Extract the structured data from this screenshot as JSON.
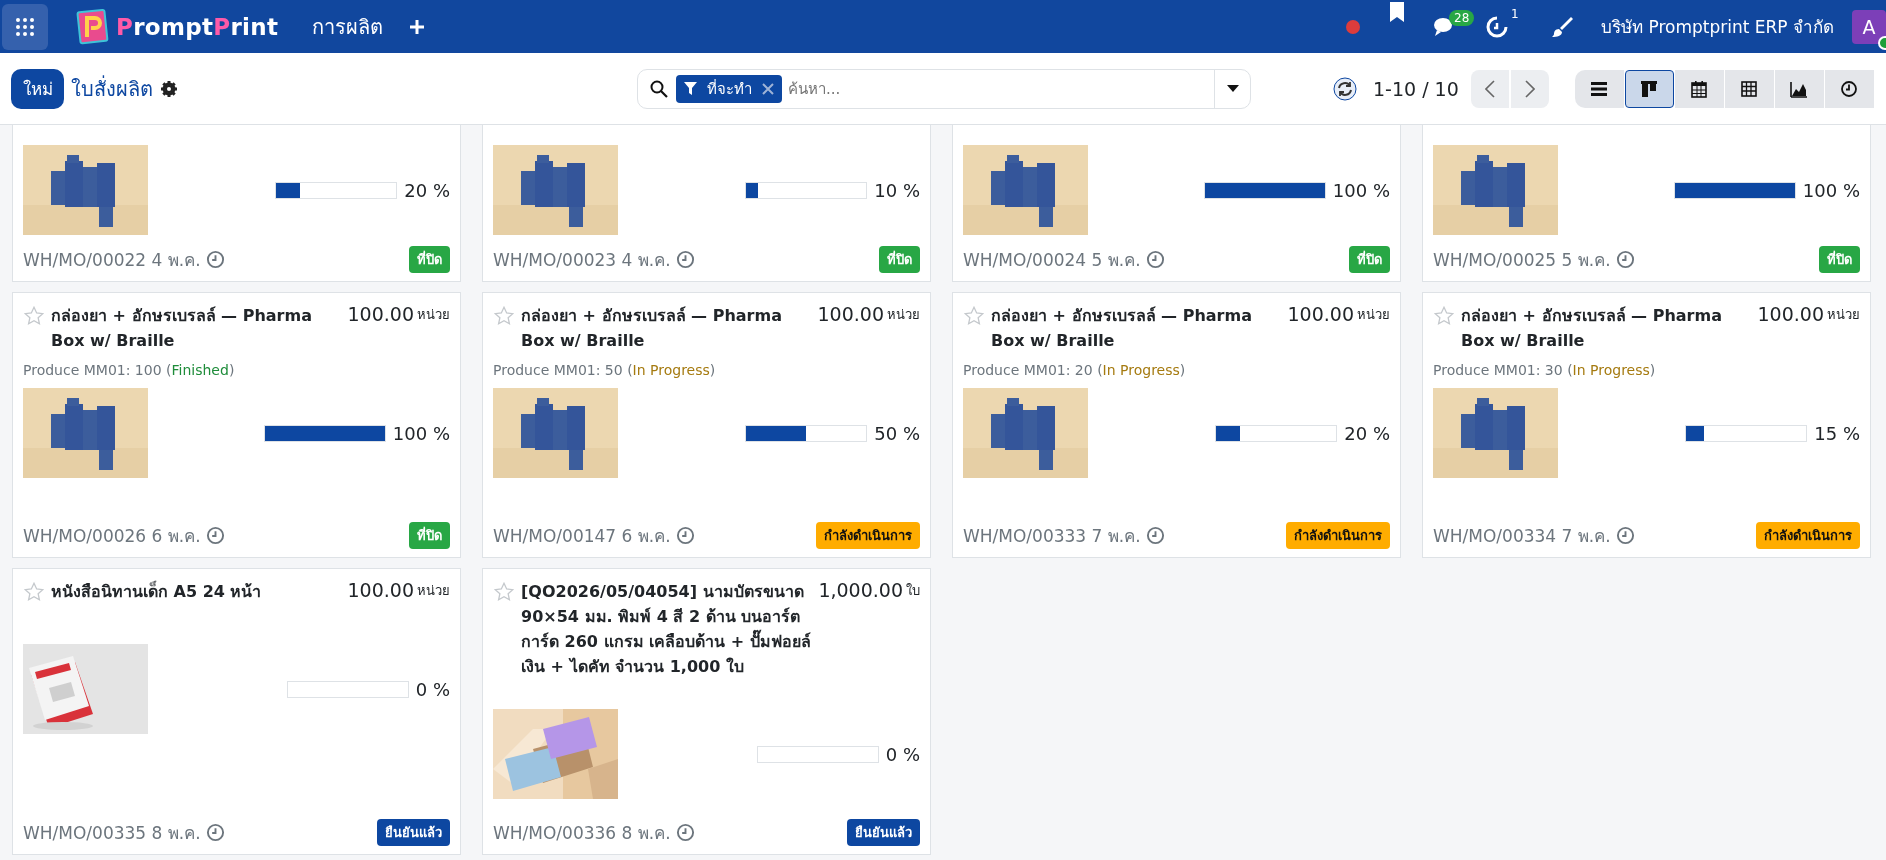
{
  "topbar": {
    "logo": [
      {
        "text": "P",
        "color": "#ff5aa8"
      },
      {
        "text": "rompt",
        "color": "#ffffff"
      },
      {
        "text": "P",
        "color": "#ff5aa8"
      },
      {
        "text": "rint",
        "color": "#ffffff"
      }
    ],
    "menu": "การผลิต",
    "messages_count": "28",
    "activities_count": "1",
    "company": "บริษัท Promptprint ERP จำกัด",
    "avatar": "A"
  },
  "control_panel": {
    "new_button": "ใหม่",
    "breadcrumb": "ใบสั่งผลิต",
    "search": {
      "facet": "ที่จะทำ",
      "placeholder": "ค้นหา..."
    },
    "pager": "1-10 / 10",
    "views": [
      {
        "kind": "list",
        "selected": false
      },
      {
        "kind": "kanban",
        "selected": true
      },
      {
        "kind": "calendar",
        "selected": false
      },
      {
        "kind": "pivot",
        "selected": false
      },
      {
        "kind": "graph",
        "selected": false
      },
      {
        "kind": "activity",
        "selected": false
      }
    ]
  },
  "cards": [
    {
      "level": 0.2,
      "percent": "20 %",
      "reference": "WH/MO/00022",
      "date": "4 พ.ค.",
      "status": {
        "label": "ที่ปิด",
        "color": "#28a745"
      }
    },
    {
      "level": 0.1,
      "percent": "10 %",
      "reference": "WH/MO/00023",
      "date": "4 พ.ค.",
      "status": {
        "label": "ที่ปิด",
        "color": "#28a745"
      }
    },
    {
      "level": 1,
      "percent": "100 %",
      "reference": "WH/MO/00024",
      "date": "5 พ.ค.",
      "status": {
        "label": "ที่ปิด",
        "color": "#28a745"
      }
    },
    {
      "level": 1,
      "percent": "100 %",
      "reference": "WH/MO/00025",
      "date": "5 พ.ค.",
      "status": {
        "label": "ที่ปิด",
        "color": "#28a745"
      }
    },
    {
      "starred": false,
      "title": "กล่องยา + อักษรเบรลล์ — Pharma Box w/ Braille",
      "quantity": "100.00",
      "unit": "หน่วย",
      "produce": {
        "before": "Produce MM01: 100 (",
        "state": "Finished",
        "after": ")",
        "color": "#1e8c3a"
      },
      "level": 1,
      "percent": "100 %",
      "reference": "WH/MO/00026",
      "date": "6 พ.ค.",
      "status": {
        "label": "ที่ปิด",
        "color": "#28a745"
      }
    },
    {
      "starred": false,
      "title": "กล่องยา + อักษรเบรลล์ — Pharma Box w/ Braille",
      "quantity": "100.00",
      "unit": "หน่วย",
      "produce": {
        "before": "Produce MM01: 50 (",
        "state": "In Progress",
        "after": ")",
        "color": "#a57a0f"
      },
      "level": 0.5,
      "percent": "50 %",
      "reference": "WH/MO/00147",
      "date": "6 พ.ค.",
      "status": {
        "label": "กำลังดำเนินการ",
        "color": "#ffac00"
      }
    },
    {
      "starred": false,
      "title": "กล่องยา + อักษรเบรลล์ — Pharma Box w/ Braille",
      "quantity": "100.00",
      "unit": "หน่วย",
      "produce": {
        "before": "Produce MM01: 20 (",
        "state": "In Progress",
        "after": ")",
        "color": "#a57a0f"
      },
      "level": 0.2,
      "percent": "20 %",
      "reference": "WH/MO/00333",
      "date": "7 พ.ค.",
      "status": {
        "label": "กำลังดำเนินการ",
        "color": "#ffac00"
      }
    },
    {
      "starred": false,
      "title": "กล่องยา + อักษรเบรลล์ — Pharma Box w/ Braille",
      "quantity": "100.00",
      "unit": "หน่วย",
      "produce": {
        "before": "Produce MM01: 30 (",
        "state": "In Progress",
        "after": ")",
        "color": "#a57a0f"
      },
      "level": 0.15,
      "percent": "15 %",
      "reference": "WH/MO/00334",
      "date": "7 พ.ค.",
      "status": {
        "label": "กำลังดำเนินการ",
        "color": "#ffac00"
      }
    },
    {
      "starred": false,
      "title": "หนังสือนิทานเด็ก A5 24 หน้า",
      "quantity": "100.00",
      "unit": "หน่วย",
      "level": 0,
      "percent": "0 %",
      "reference": "WH/MO/00335",
      "date": "8 พ.ค.",
      "status": {
        "label": "ยืนยันแล้ว",
        "color": "#0d47a1"
      }
    },
    {
      "starred": false,
      "title": "[QO2026/05/04054] นามบัตรขนาด 90×54 มม. พิมพ์ 4 สี 2 ด้าน บนอาร์ตการ์ด 260 แกรม เคลือบด้าน + ปั๊มฟอยล์เงิน + ไดคัท จำนวน 1,000 ใบ",
      "quantity": "1,000.00",
      "unit": "ใบ",
      "level": 0,
      "percent": "0 %",
      "reference": "WH/MO/00336",
      "date": "8 พ.ค.",
      "status": {
        "label": "ยืนยันแล้ว",
        "color": "#0d47a1"
      }
    }
  ]
}
